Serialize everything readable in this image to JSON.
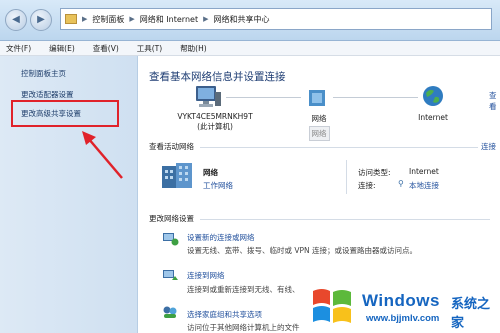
{
  "address": {
    "crumbs": [
      "控制面板",
      "网络和 Internet",
      "网络和共享中心"
    ]
  },
  "menu": [
    "文件(F)",
    "编辑(E)",
    "查看(V)",
    "工具(T)",
    "帮助(H)"
  ],
  "sidebar": {
    "items": [
      "控制面板主页",
      "更改适配器设置",
      "更改高级共享设置"
    ]
  },
  "main": {
    "title": "查看基本网络信息并设置连接",
    "right_link": "查看",
    "map": [
      {
        "label": "VYKT4CE5MRNKH9T",
        "sub": "(此计算机)"
      },
      {
        "label": "网络",
        "sub": "网络"
      },
      {
        "label": "Internet",
        "sub": ""
      }
    ],
    "active": {
      "header": "查看活动网络",
      "right_link": "连接",
      "network_name": "网络",
      "network_type": "工作网络",
      "access_label": "访问类型:",
      "access_value": "Internet",
      "conn_label": "连接:",
      "conn_value": "本地连接"
    },
    "change": {
      "header": "更改网络设置",
      "items": [
        {
          "link": "设置新的连接或网络",
          "desc": "设置无线、宽带、拨号、临时或 VPN 连接；或设置路由器或访问点。"
        },
        {
          "link": "连接到网络",
          "desc": "连接到或重新连接到无线、有线、"
        },
        {
          "link": "选择家庭组和共享选项",
          "desc": "访问位于其他网络计算机上的文件"
        }
      ]
    }
  },
  "watermark": {
    "brand": "Windows",
    "cn": "系统之家",
    "url": "www.bjjmlv.com"
  },
  "colors": {
    "highlight": "#e0222a",
    "link": "#1f4e9b",
    "accent": "#1565c0"
  }
}
